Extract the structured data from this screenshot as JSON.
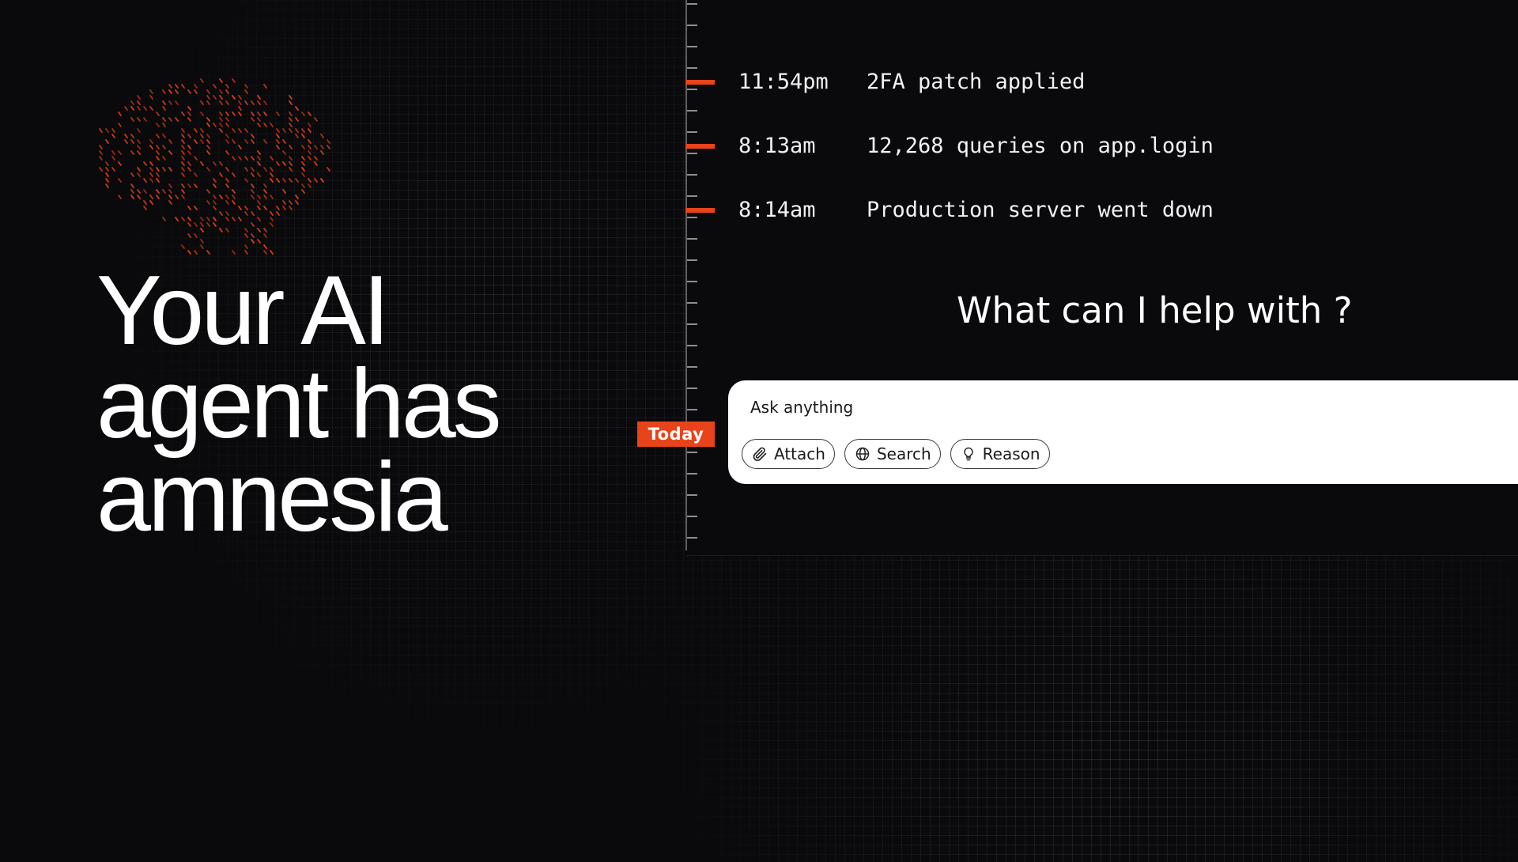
{
  "hero": {
    "headline_lines": [
      "Your AI",
      "agent has",
      "amnesia"
    ]
  },
  "timeline": {
    "events": [
      {
        "time": "11:54pm",
        "text": "2FA patch applied"
      },
      {
        "time": "8:13am",
        "text": "12,268 queries on app.login"
      },
      {
        "time": "8:14am",
        "text": "Production server went down"
      }
    ],
    "today_label": "Today"
  },
  "assistant": {
    "prompt": "What can I help with ?",
    "input_placeholder": "Ask anything",
    "actions": {
      "attach": "Attach",
      "search": "Search",
      "reason": "Reason"
    }
  },
  "colors": {
    "background": "#0a090c",
    "accent": "#e8431a",
    "text": "#ffffff",
    "card": "#ffffff"
  },
  "icons": {
    "logo": "orange-dot-matrix-logo",
    "attach": "paperclip-icon",
    "search": "globe-icon",
    "reason": "lightbulb-icon"
  }
}
